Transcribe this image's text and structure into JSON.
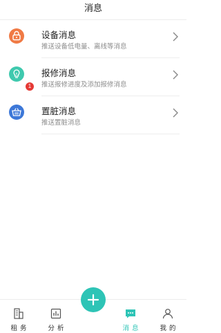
{
  "header": {
    "title": "消息"
  },
  "messages": [
    {
      "title": "设备消息",
      "subtitle": "推送设备低电量、离线等消息",
      "icon": "device-lock-icon",
      "color": "#f07a45"
    },
    {
      "title": "报修消息",
      "subtitle": "推送报修进度及添加报修消息",
      "icon": "lightbulb-icon",
      "color": "#3fc9ae"
    },
    {
      "title": "置脏消息",
      "subtitle": "推送置脏消息",
      "icon": "basket-icon",
      "color": "#3d78d8",
      "badge": "1"
    }
  ],
  "tabbar": {
    "tabs": [
      {
        "label": "租务",
        "icon": "building-icon"
      },
      {
        "label": "分析",
        "icon": "chart-icon"
      },
      {
        "label": "",
        "icon": "plus-icon"
      },
      {
        "label": "消息",
        "icon": "message-icon",
        "active": true
      },
      {
        "label": "我的",
        "icon": "user-icon"
      }
    ],
    "accent": "#2ec4b6"
  }
}
